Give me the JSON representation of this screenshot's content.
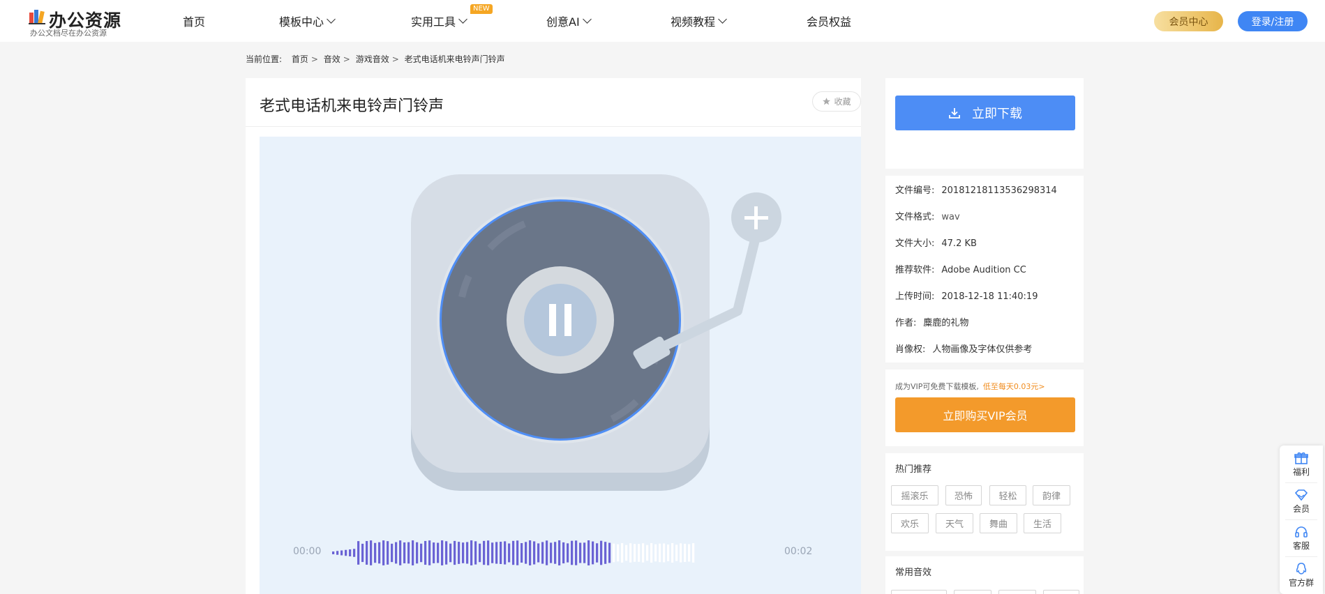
{
  "header": {
    "logo_title": "办公资源",
    "logo_subtitle": "办公文档尽在办公资源",
    "nav": [
      {
        "label": "首页",
        "has_dropdown": false
      },
      {
        "label": "模板中心",
        "has_dropdown": true
      },
      {
        "label": "实用工具",
        "has_dropdown": true
      },
      {
        "label": "创意AI",
        "has_dropdown": true
      },
      {
        "label": "视频教程",
        "has_dropdown": true
      },
      {
        "label": "会员权益",
        "has_dropdown": false
      }
    ],
    "new_badge": "NEW",
    "vip_center": "会员中心",
    "login": "登录/注册"
  },
  "breadcrumb": {
    "prefix": "当前位置:",
    "items": [
      "首页",
      "音效",
      "游戏音效",
      "老式电话机来电铃声门铃声"
    ],
    "separator": ">"
  },
  "main": {
    "title": "老式电话机来电铃声门铃声",
    "favorite_label": "收藏",
    "player": {
      "state": "playing",
      "time_current": "00:00",
      "time_total": "00:02",
      "progress": 0.77
    }
  },
  "sidebar": {
    "download_label": "立即下载",
    "info": [
      {
        "label": "文件编号:",
        "value": "20181218113536298314"
      },
      {
        "label": "文件格式:",
        "value": "wav"
      },
      {
        "label": "文件大小:",
        "value": "47.2 KB"
      },
      {
        "label": "推荐软件:",
        "value": "Adobe Audition CC"
      },
      {
        "label": "上传时间:",
        "value": "2018-12-18 11:40:19"
      },
      {
        "label": "作者:",
        "value": "麋鹿的礼物"
      },
      {
        "label": "肖像权:",
        "value": "人物画像及字体仅供参考"
      }
    ],
    "vip_note": "成为VIP可免费下载模板,",
    "vip_price": "低至每天0.03元>",
    "buy_vip_label": "立即购买VIP会员",
    "hot_title": "热门推荐",
    "hot_tags": [
      "摇滚乐",
      "恐怖",
      "轻松",
      "韵律",
      "欢乐",
      "天气",
      "舞曲",
      "生活"
    ],
    "common_title": "常用音效"
  },
  "float_bar": [
    {
      "label": "福利",
      "icon": "gift-icon"
    },
    {
      "label": "会员",
      "icon": "diamond-icon"
    },
    {
      "label": "客服",
      "icon": "headset-icon"
    },
    {
      "label": "官方群",
      "icon": "qq-penguin-icon"
    }
  ],
  "colors": {
    "primary_blue": "#4d8df5",
    "vip_orange": "#f39a2b",
    "waveform_played": "#6a63d4",
    "waveform_unplayed": "#ffffff",
    "player_bg": "#e9f2fb"
  }
}
